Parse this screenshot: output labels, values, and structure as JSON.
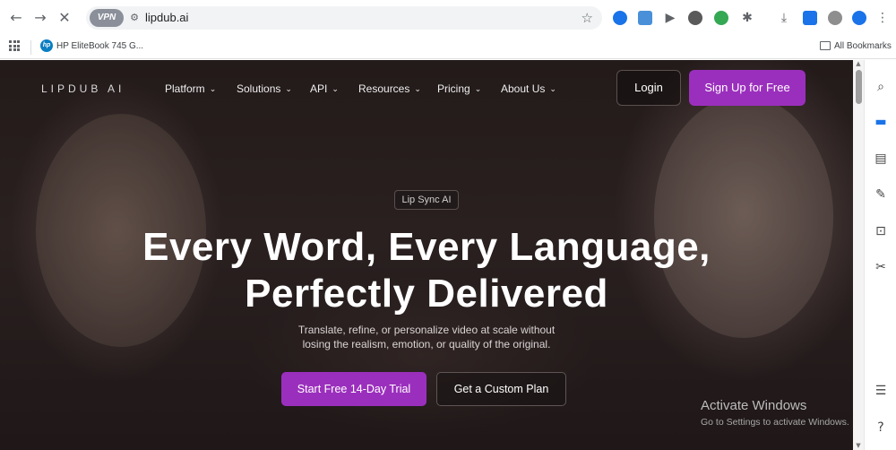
{
  "browser": {
    "url": "lipdub.ai",
    "vpn_label": "VPN",
    "bookmark_item": "HP EliteBook 745 G...",
    "all_bookmarks": "All Bookmarks"
  },
  "nav": {
    "logo": "LIPDUB AI",
    "menu": [
      "Platform",
      "Solutions",
      "API",
      "Resources",
      "Pricing",
      "About Us"
    ],
    "login": "Login",
    "signup": "Sign Up for Free"
  },
  "hero": {
    "badge": "Lip Sync AI",
    "headline_line1": "Every Word, Every Language,",
    "headline_line2": "Perfectly Delivered",
    "sub_line1": "Translate, refine, or personalize video at scale without",
    "sub_line2": "losing the realism, emotion, or quality of the original.",
    "cta_primary": "Start Free 14-Day Trial",
    "cta_secondary": "Get a Custom Plan"
  },
  "watermark": {
    "title": "Activate Windows",
    "subtitle": "Go to Settings to activate Windows."
  },
  "colors": {
    "accent": "#9b2fbd",
    "page_bg": "#231a1a"
  }
}
